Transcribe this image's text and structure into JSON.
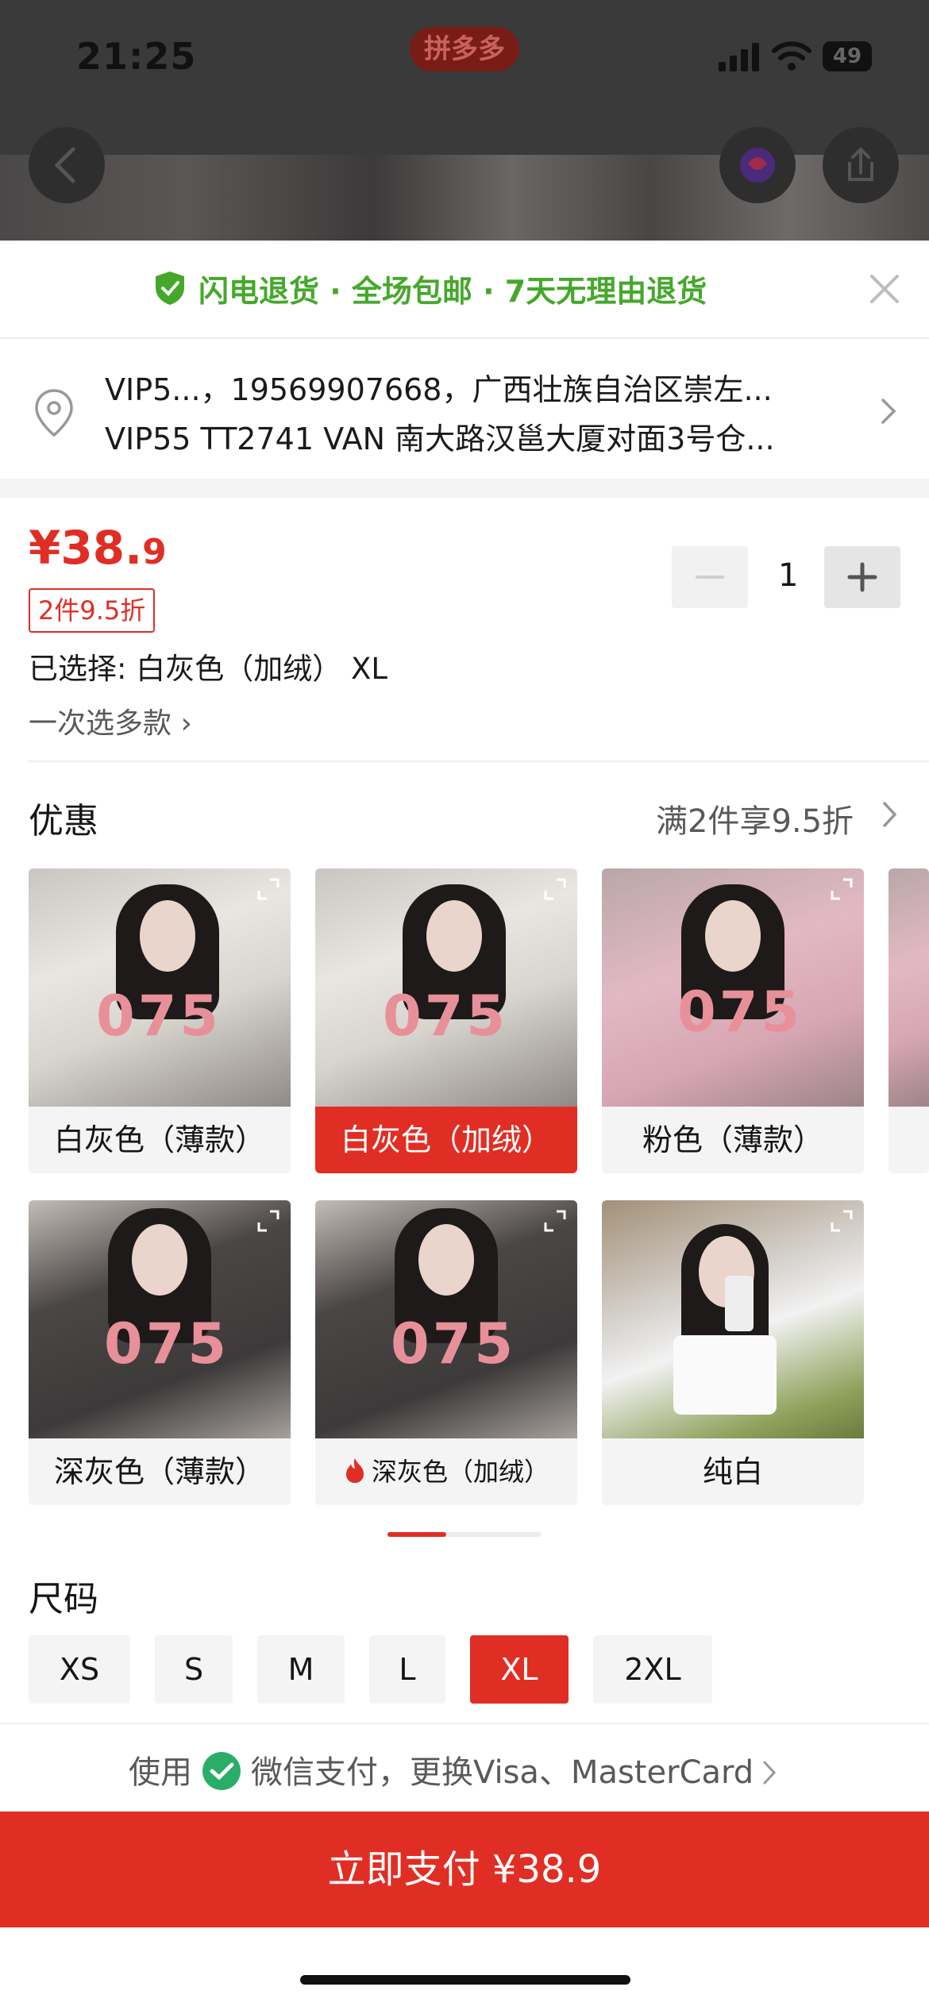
{
  "status_bar": {
    "time": "21:25",
    "app_badge": "拼多多",
    "battery": "49"
  },
  "promo": {
    "text": "闪电退货 · 全场包邮 · 7天无理由退货",
    "close_symbol": "×"
  },
  "address": {
    "line1": "VIP5...，19569907668，广西壮族自治区崇左...",
    "line2": "VIP55 TT2741 VAN  南大路汉邕大厦对面3号仓..."
  },
  "product": {
    "price_main": "¥38.",
    "price_decimal": "9",
    "discount_tag": "2件9.5折",
    "selected": "已选择: 白灰色（加绒） XL",
    "multi_select": "一次选多款 ›",
    "quantity": "1",
    "minus": "−",
    "plus": "+"
  },
  "youhui": {
    "title": "优惠",
    "detail": "满2件享9.5折"
  },
  "variants": [
    {
      "label": "白灰色（薄款）",
      "num": "075",
      "selected": false
    },
    {
      "label": "白灰色（加绒）",
      "num": "075",
      "selected": true
    },
    {
      "label": "粉色（薄款）",
      "num": "075",
      "selected": false
    },
    {
      "label": "深灰色（薄款）",
      "num": "075",
      "selected": false
    },
    {
      "label": "深灰色（加绒）",
      "num": "075",
      "selected": false,
      "hot": true
    },
    {
      "label": "纯白",
      "num": "",
      "selected": false
    }
  ],
  "size": {
    "title": "尺码",
    "options": [
      "XS",
      "S",
      "M",
      "L",
      "XL",
      "2XL"
    ],
    "selected": "XL"
  },
  "payment": {
    "note_prefix": "使用",
    "note_suffix": "微信支付，更换Visa、MasterCard",
    "pay_button": "立即支付 ¥38.9"
  },
  "colors": {
    "accent": "#e02e24",
    "promo_green": "#45a82b",
    "wechat_green": "#2aae67"
  }
}
